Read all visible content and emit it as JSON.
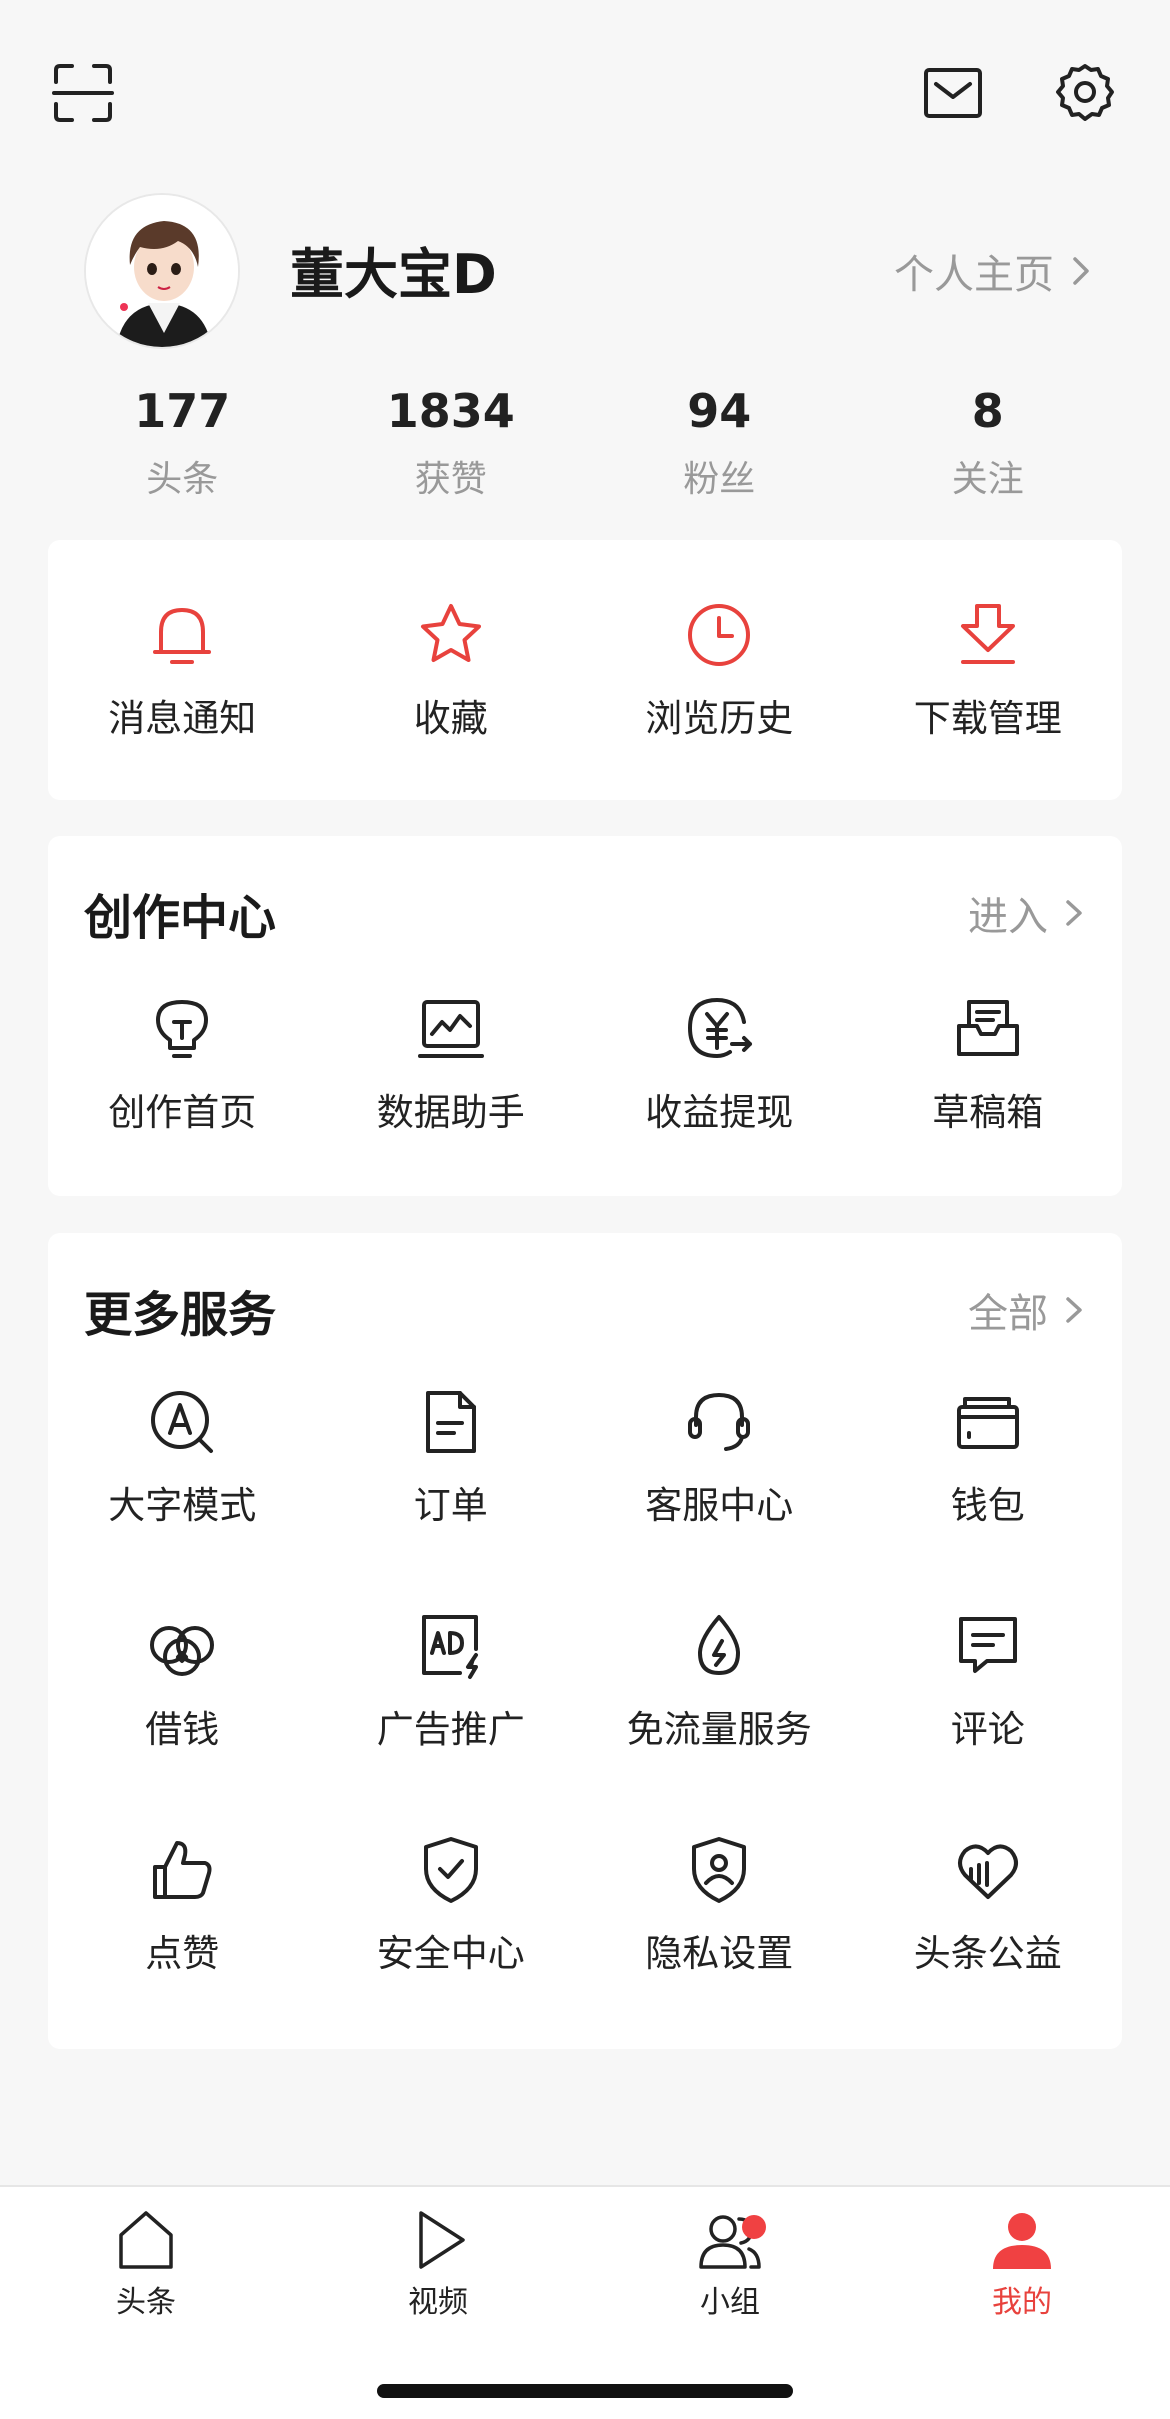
{
  "profile": {
    "username": "董大宝D",
    "homepage_link": "个人主页",
    "avatar_signature": "董大宝"
  },
  "stats": [
    {
      "value": "177",
      "label": "头条"
    },
    {
      "value": "1834",
      "label": "获赞"
    },
    {
      "value": "94",
      "label": "粉丝"
    },
    {
      "value": "8",
      "label": "关注"
    }
  ],
  "quick_actions": [
    {
      "label": "消息通知",
      "icon": "bell-icon"
    },
    {
      "label": "收藏",
      "icon": "star-icon"
    },
    {
      "label": "浏览历史",
      "icon": "clock-icon"
    },
    {
      "label": "下载管理",
      "icon": "download-icon"
    }
  ],
  "creation_center": {
    "title": "创作中心",
    "link": "进入",
    "items": [
      {
        "label": "创作首页",
        "icon": "lightbulb-icon"
      },
      {
        "label": "数据助手",
        "icon": "chart-monitor-icon"
      },
      {
        "label": "收益提现",
        "icon": "yuan-withdraw-icon"
      },
      {
        "label": "草稿箱",
        "icon": "draft-box-icon"
      }
    ]
  },
  "more_services": {
    "title": "更多服务",
    "link": "全部",
    "items": [
      {
        "label": "大字模式",
        "icon": "large-text-icon"
      },
      {
        "label": "订单",
        "icon": "order-document-icon"
      },
      {
        "label": "客服中心",
        "icon": "headset-icon"
      },
      {
        "label": "钱包",
        "icon": "wallet-icon"
      },
      {
        "label": "借钱",
        "icon": "loan-icon"
      },
      {
        "label": "广告推广",
        "icon": "ad-icon"
      },
      {
        "label": "免流量服务",
        "icon": "data-drop-icon"
      },
      {
        "label": "评论",
        "icon": "comment-icon"
      },
      {
        "label": "点赞",
        "icon": "thumbs-up-icon"
      },
      {
        "label": "安全中心",
        "icon": "shield-check-icon"
      },
      {
        "label": "隐私设置",
        "icon": "privacy-shield-icon"
      },
      {
        "label": "头条公益",
        "icon": "charity-heart-icon"
      }
    ]
  },
  "bottom_nav": [
    {
      "label": "头条",
      "icon": "home-icon",
      "active": false
    },
    {
      "label": "视频",
      "icon": "play-icon",
      "active": false
    },
    {
      "label": "小组",
      "icon": "group-icon",
      "active": false,
      "badge": true
    },
    {
      "label": "我的",
      "icon": "person-icon",
      "active": true
    }
  ],
  "colors": {
    "accent_red": "#e8423d",
    "background": "#f7f7f7",
    "card": "#ffffff",
    "muted_text": "#999999"
  }
}
